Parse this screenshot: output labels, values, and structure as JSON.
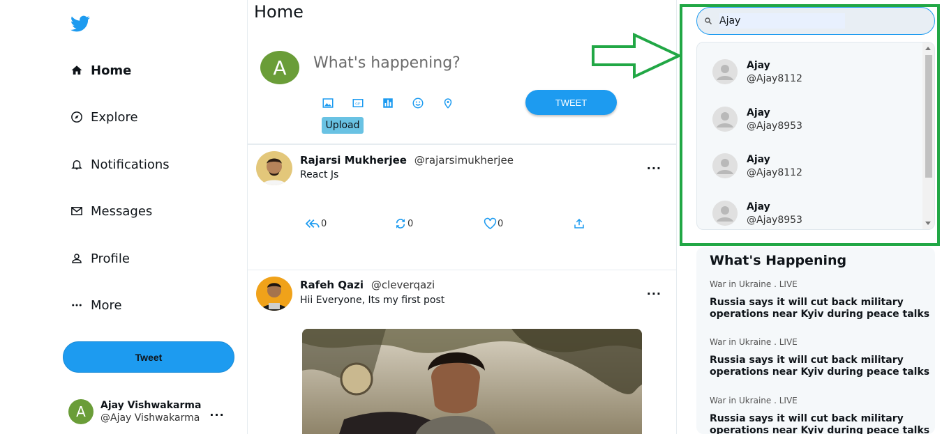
{
  "sidebar": {
    "logo": "twitter-bird-icon",
    "nav": [
      {
        "label": "Home",
        "icon": "home-icon",
        "active": true
      },
      {
        "label": "Explore",
        "icon": "compass-icon"
      },
      {
        "label": "Notifications",
        "icon": "bell-icon"
      },
      {
        "label": "Messages",
        "icon": "mail-icon"
      },
      {
        "label": "Profile",
        "icon": "person-icon"
      },
      {
        "label": "More",
        "icon": "more-dots-icon"
      }
    ],
    "tweet_button": "Tweet",
    "user": {
      "initial": "A",
      "name": "Ajay Vishwakarma",
      "handle": "@Ajay Vishwakarma",
      "more": "..."
    }
  },
  "feed": {
    "title": "Home",
    "compose": {
      "avatar_initial": "A",
      "placeholder": "What's happening?",
      "tools": [
        "image-icon",
        "gif-icon",
        "poll-icon",
        "emoji-icon",
        "location-icon"
      ],
      "upload_label": "Upload",
      "tweet_label": "TWEET"
    },
    "posts": [
      {
        "name": "Rajarsi Mukherjee",
        "handle": "@rajarsimukherjee",
        "text": "React Js",
        "reply_count": "0",
        "retweet_count": "0",
        "like_count": "0",
        "more": "..."
      },
      {
        "name": "Rafeh Qazi",
        "handle": "@cleverqazi",
        "text": "Hii Everyone, Its my first post",
        "more": "..."
      }
    ]
  },
  "search": {
    "value": "Ajay",
    "results": [
      {
        "name": "Ajay",
        "handle": "@Ajay8112"
      },
      {
        "name": "Ajay",
        "handle": "@Ajay8953"
      },
      {
        "name": "Ajay",
        "handle": "@Ajay8112"
      },
      {
        "name": "Ajay",
        "handle": "@Ajay8953"
      }
    ]
  },
  "happening": {
    "title": "What's Happening",
    "items": [
      {
        "category": "War in Ukraine . LIVE",
        "headline": "Russia says it will cut back military operations near Kyiv during peace talks"
      },
      {
        "category": "War in Ukraine . LIVE",
        "headline": "Russia says it will cut back military operations near Kyiv during peace talks"
      },
      {
        "category": "War in Ukraine . LIVE",
        "headline": "Russia says it will cut back military operations near Kyiv during peace talks"
      }
    ]
  },
  "colors": {
    "accent": "#1d9bf0",
    "highlight": "#21a745",
    "avatar_green": "#6a9d38"
  }
}
